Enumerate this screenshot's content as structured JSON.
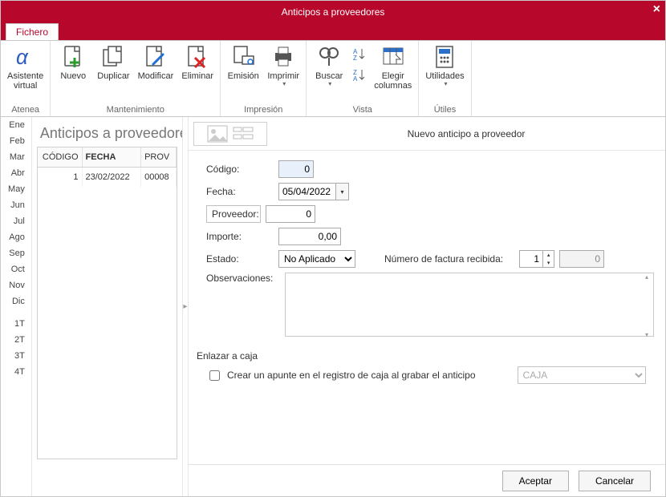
{
  "window": {
    "title": "Anticipos a proveedores"
  },
  "tab": {
    "file": "Fichero"
  },
  "ribbon": {
    "atenea": {
      "label": "Asistente\nvirtual",
      "group": "Atenea"
    },
    "nuevo": "Nuevo",
    "duplicar": "Duplicar",
    "modificar": "Modificar",
    "eliminar": "Eliminar",
    "mant_group": "Mantenimiento",
    "emision": "Emisión",
    "imprimir": "Imprimir",
    "impr_group": "Impresión",
    "buscar": "Buscar",
    "elegir": "Elegir\ncolumnas",
    "vista_group": "Vista",
    "utilidades": "Utilidades",
    "utiles_group": "Útiles"
  },
  "months": [
    "Ene",
    "Feb",
    "Mar",
    "Abr",
    "May",
    "Jun",
    "Jul",
    "Ago",
    "Sep",
    "Oct",
    "Nov",
    "Dic",
    "",
    "1T",
    "2T",
    "3T",
    "4T"
  ],
  "list": {
    "title": "Anticipos a proveedores",
    "cols": {
      "codigo": "CÓDIGO",
      "fecha": "FECHA",
      "prov": "PROV"
    },
    "rows": [
      {
        "codigo": "1",
        "fecha": "23/02/2022",
        "prov": "00008"
      }
    ]
  },
  "form": {
    "header": "Nuevo anticipo a proveedor",
    "labels": {
      "codigo": "Código:",
      "fecha": "Fecha:",
      "proveedor": "Proveedor:",
      "importe": "Importe:",
      "estado": "Estado:",
      "numfact": "Número de factura recibida:",
      "observ": "Observaciones:"
    },
    "values": {
      "codigo": "0",
      "fecha": "05/04/2022",
      "proveedor": "0",
      "importe": "0,00",
      "estado": "No Aplicado",
      "numfact_a": "1",
      "numfact_b": "0"
    },
    "enlace_head": "Enlazar a caja",
    "enlace_chk": "Crear un apunte en el registro de caja al grabar el anticipo",
    "caja": "CAJA"
  },
  "footer": {
    "ok": "Aceptar",
    "cancel": "Cancelar"
  }
}
